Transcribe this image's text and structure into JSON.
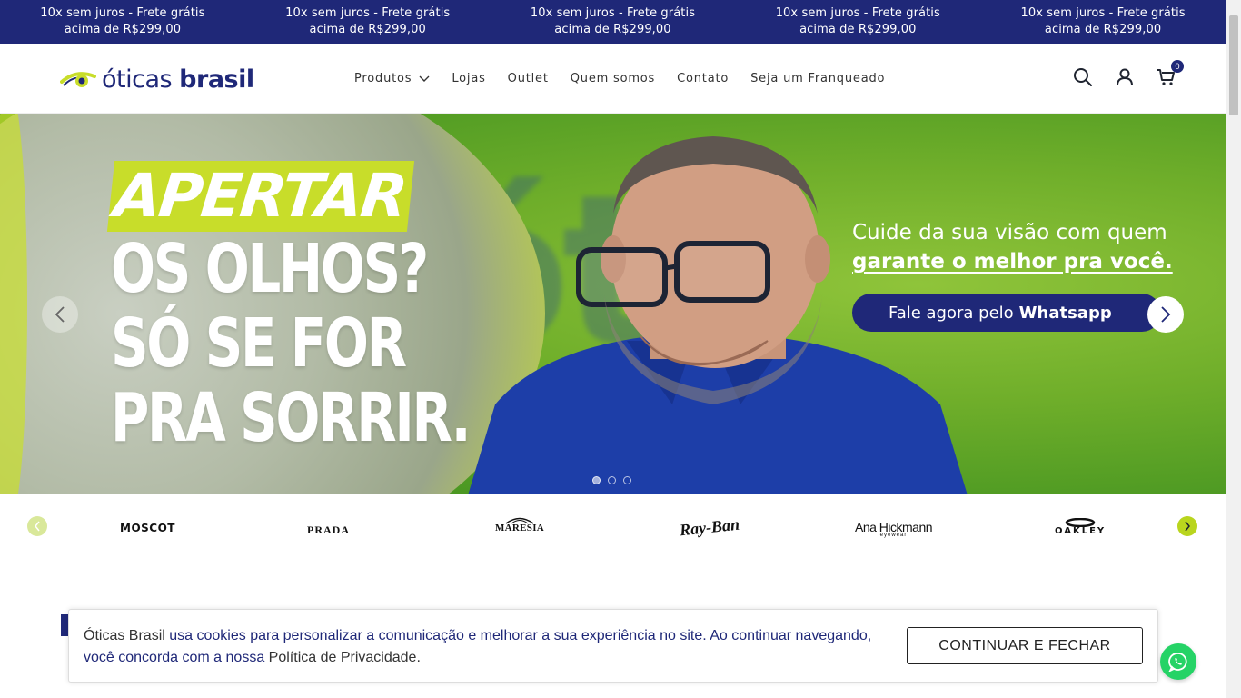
{
  "topbar": {
    "promos": [
      {
        "line1": "10x sem juros - Frete grátis",
        "line2": "acima de R$299,00"
      },
      {
        "line1": "10x sem juros - Frete grátis",
        "line2": "acima de R$299,00"
      },
      {
        "line1": "10x sem juros - Frete grátis",
        "line2": "acima de R$299,00"
      },
      {
        "line1": "10x sem juros - Frete grátis",
        "line2": "acima de R$299,00"
      },
      {
        "line1": "10x sem juros - Frete grátis",
        "line2": "acima de R$299,00"
      }
    ]
  },
  "header": {
    "logo_light": "óticas",
    "logo_bold": "brasil",
    "nav": [
      "Produtos",
      "Lojas",
      "Outlet",
      "Quem somos",
      "Contato",
      "Seja um Franqueado"
    ],
    "cart_count": "0"
  },
  "hero": {
    "headline_1": "APERTAR",
    "headline_2": "OS OLHOS?",
    "headline_3": "SÓ SE FOR",
    "headline_4": "PRA SORRIR.",
    "tagline_1": "Cuide da sua visão com quem",
    "tagline_2": "garante o melhor pra você.",
    "cta_prefix": "Fale agora pelo",
    "cta_bold": "Whatsapp",
    "slide_count": 3,
    "active_slide": 1
  },
  "brands": {
    "moscot": "MOSCOT",
    "prada": "PRADA",
    "maresia": "MARESIA",
    "rayban": "Ray-Ban",
    "anahickmann": "Ana Hickmann",
    "anahickmann_sub": "eyewear",
    "oakley": "OAKLEY"
  },
  "cookie": {
    "brand": "Óticas Brasil",
    "text_1": "usa cookies para personalizar a comunicação e melhorar a sua experiência no site. Ao continuar navegando, você concorda com a nossa",
    "policy": "Política de Privacidade",
    "end": ".",
    "button": "CONTINUAR E FECHAR"
  },
  "colors": {
    "brand_navy": "#1f2878",
    "brand_lime": "#c8dd2a",
    "whatsapp": "#25d366"
  }
}
